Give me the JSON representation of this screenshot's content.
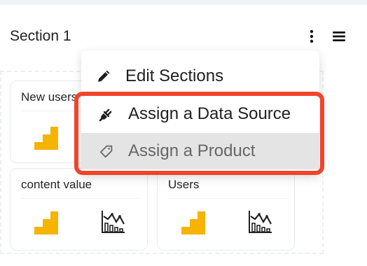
{
  "header": {
    "section_title": "Section 1",
    "kebab_icon": "vertical-dots-icon",
    "hamburger_icon": "hamburger-menu-icon"
  },
  "cards": [
    {
      "title": "New users",
      "icons": [
        "stairs-icon"
      ]
    },
    {
      "title": "content value",
      "icons": [
        "stairs-icon",
        "line-bar-chart-icon"
      ]
    },
    {
      "title": "Users",
      "icons": [
        "stairs-icon",
        "line-bar-chart-icon"
      ]
    }
  ],
  "menu": {
    "items": [
      {
        "label": "Edit Sections",
        "icon": "pencil-icon"
      },
      {
        "label": "Assign a Data Source",
        "icon": "plug-icon"
      },
      {
        "label": "Assign a Product",
        "icon": "tag-icon"
      }
    ]
  },
  "colors": {
    "accent_highlight": "#f0452a",
    "stairs": "#f4b400",
    "menu_hover": "#e4e4e4"
  }
}
